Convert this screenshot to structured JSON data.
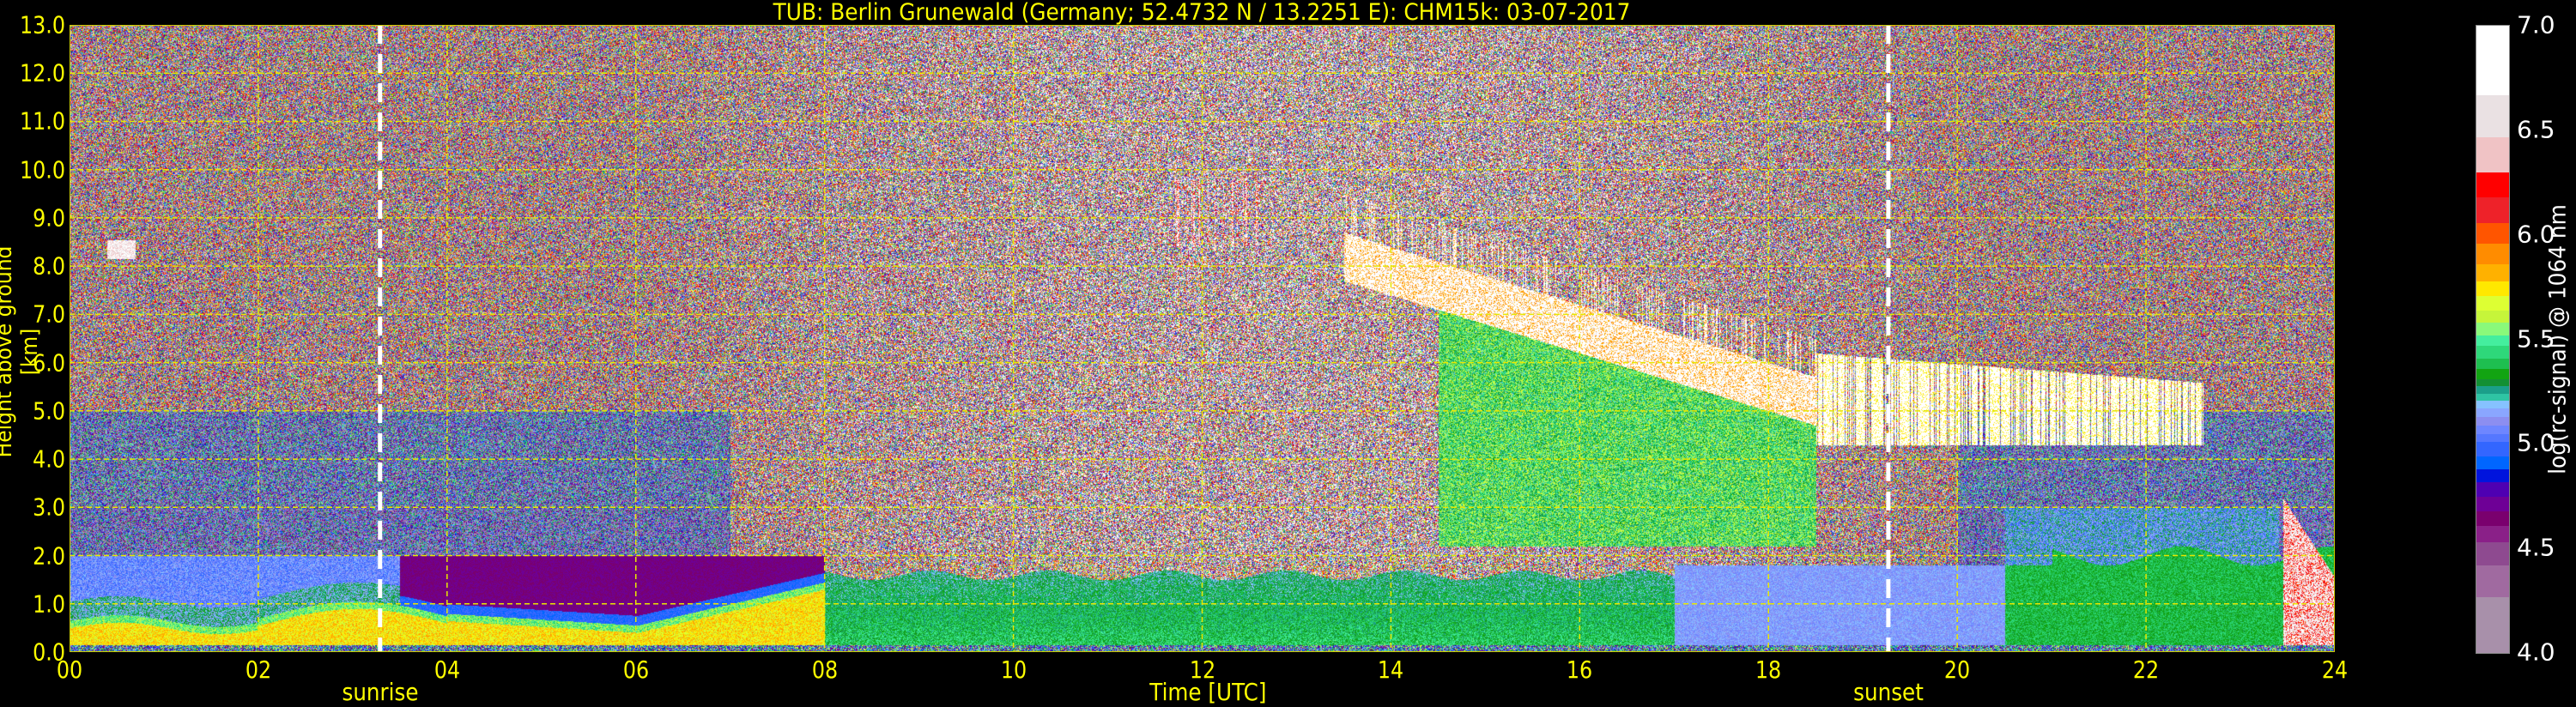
{
  "chart_data": {
    "type": "heatmap",
    "title": "TUB: Berlin Grunewald (Germany; 52.4732 N / 13.2251 E):    CHM15k: 03-07-2017",
    "xlabel": "Time [UTC]",
    "ylabel": "Height above ground [km]",
    "xlim": [
      0,
      24
    ],
    "ylim": [
      0,
      13
    ],
    "xticks": [
      "00",
      "02",
      "04",
      "06",
      "08",
      "10",
      "12",
      "14",
      "16",
      "18",
      "20",
      "22",
      "24"
    ],
    "xtick_values": [
      0,
      2,
      4,
      6,
      8,
      10,
      12,
      14,
      16,
      18,
      20,
      22,
      24
    ],
    "yticks": [
      "0.0",
      "1.0",
      "2.0",
      "3.0",
      "4.0",
      "5.0",
      "6.0",
      "7.0",
      "8.0",
      "9.0",
      "10.0",
      "11.0",
      "12.0",
      "13.0"
    ],
    "ytick_values": [
      0,
      1,
      2,
      3,
      4,
      5,
      6,
      7,
      8,
      9,
      10,
      11,
      12,
      13
    ],
    "grid": true,
    "annotations": [
      {
        "label": "sunrise",
        "time": 3.29
      },
      {
        "label": "sunset",
        "time": 19.27
      }
    ],
    "colorbar": {
      "label": "log(rc-signal) @ 1064 nm",
      "range": [
        4.0,
        7.0
      ],
      "ticks": [
        "4.0",
        "4.5",
        "5.0",
        "5.5",
        "6.0",
        "6.5",
        "7.0"
      ],
      "tick_values": [
        4.0,
        4.5,
        5.0,
        5.5,
        6.0,
        6.5,
        7.0
      ],
      "level_edges": [
        4.0,
        4.27,
        4.42,
        4.53,
        4.61,
        4.68,
        4.75,
        4.82,
        4.88,
        4.94,
        5.01,
        5.05,
        5.09,
        5.13,
        5.17,
        5.21,
        5.24,
        5.28,
        5.31,
        5.36,
        5.41,
        5.47,
        5.52,
        5.58,
        5.64,
        5.71,
        5.78,
        5.86,
        5.96,
        6.06,
        6.18,
        6.3,
        6.47,
        6.67,
        7.0
      ],
      "colors": [
        "#a890aa",
        "#a06aa0",
        "#8e4a90",
        "#8a2088",
        "#7a006e",
        "#6e0096",
        "#4e00b2",
        "#0014dd",
        "#0066ff",
        "#3366ff",
        "#5577ff",
        "#6e86ff",
        "#8c8ef0",
        "#8aa6ff",
        "#86c2ff",
        "#2fc4a4",
        "#1b9f8a",
        "#139034",
        "#12a412",
        "#1ebf50",
        "#2ed87a",
        "#44ee9e",
        "#8af97a",
        "#c6f53a",
        "#ddff33",
        "#ffe800",
        "#ffb100",
        "#ff8c00",
        "#ff5500",
        "#ee2229",
        "#ff0000",
        "#f0c3c5",
        "#eae1e3",
        "#ffffff"
      ]
    },
    "features": [
      {
        "name": "nocturnal residual layer",
        "time": [
          0,
          8
        ],
        "height": [
          0.15,
          2.0
        ],
        "log_signal": 5.1
      },
      {
        "name": "stable surface aerosol layer",
        "time": [
          0,
          8
        ],
        "height": [
          0.15,
          1.0
        ],
        "log_signal": 5.7
      },
      {
        "name": "convective boundary layer",
        "time": [
          8,
          17
        ],
        "height": [
          0.15,
          1.7
        ],
        "log_signal": 5.3
      },
      {
        "name": "evening layer",
        "time": [
          17,
          20.5
        ],
        "height": [
          0.15,
          1.8
        ],
        "log_signal": 5.1
      },
      {
        "name": "night layer",
        "time": [
          20.5,
          23.4
        ],
        "height": [
          0.15,
          2.2
        ],
        "log_signal": 5.35
      },
      {
        "name": "small cloud",
        "time": [
          0.4,
          0.7
        ],
        "height": [
          8.1,
          8.6
        ],
        "log_signal": 6.6
      },
      {
        "name": "cirrus",
        "time": [
          11.5,
          12.5
        ],
        "height": [
          8.4,
          9.8
        ],
        "log_signal": 6.8
      },
      {
        "name": "descending cirrus",
        "time": [
          13.5,
          18.5
        ],
        "height": [
          4.8,
          8.8
        ],
        "log_signal": 6.9
      },
      {
        "name": "mid-level cloud",
        "time": [
          18.5,
          22.6
        ],
        "height": [
          4.3,
          6.2
        ],
        "log_signal": 6.9
      },
      {
        "name": "low cloud",
        "time": [
          23.45,
          24
        ],
        "height": [
          0,
          3.2
        ],
        "log_signal": 6.5
      }
    ]
  }
}
